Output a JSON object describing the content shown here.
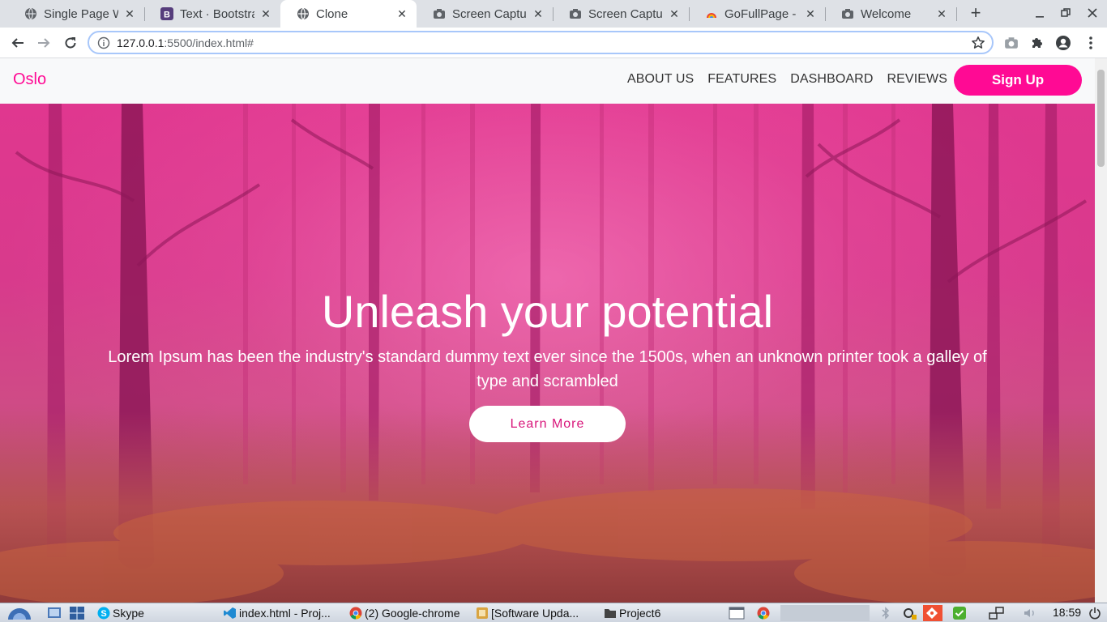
{
  "browser": {
    "tabs": [
      {
        "title": "Single Page We",
        "icon": "globe-icon",
        "active": false
      },
      {
        "title": "Text · Bootstrap",
        "icon": "bootstrap-icon",
        "active": false
      },
      {
        "title": "Clone",
        "icon": "globe-icon",
        "active": true
      },
      {
        "title": "Screen Capture",
        "icon": "camera-icon",
        "active": false
      },
      {
        "title": "Screen Capture",
        "icon": "camera-icon",
        "active": false
      },
      {
        "title": "GoFullPage - Fu",
        "icon": "gofullpage-icon",
        "active": false
      },
      {
        "title": "Welcome",
        "icon": "camera-icon",
        "active": false
      }
    ],
    "close_glyph": "✕",
    "new_tab_glyph": "+",
    "url_host": "127.0.0.1",
    "url_rest": ":5500/index.html#"
  },
  "site": {
    "brand": "Oslo",
    "nav": [
      "ABOUT US",
      "FEATURES",
      "DASHBOARD",
      "REVIEWS"
    ],
    "signup_label": "Sign Up",
    "brand_color": "#ff0a94"
  },
  "hero": {
    "title": "Unleash your potential",
    "text": "Lorem Ipsum has been the industry's standard dummy text ever since the 1500s, when an unknown printer took a galley of type and scrambled",
    "button_label": "Learn More"
  },
  "taskbar": {
    "items": [
      {
        "label": "Skype",
        "icon": "skype-icon"
      },
      {
        "label": "index.html - Proj...",
        "icon": "vscode-icon"
      },
      {
        "label": "(2) Google-chrome",
        "icon": "chrome-icon"
      },
      {
        "label": "[Software Upda...",
        "icon": "software-update-icon"
      },
      {
        "label": "Project6",
        "icon": "folder-icon"
      }
    ],
    "clock": "18:59"
  }
}
